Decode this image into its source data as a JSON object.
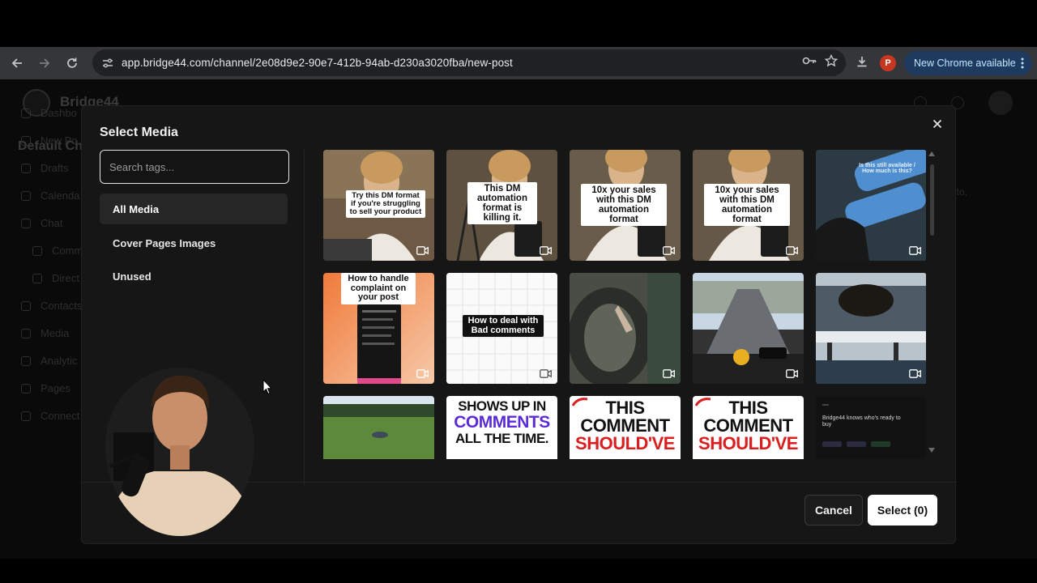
{
  "browser": {
    "url": "app.bridge44.com/channel/2e08d9e2-90e7-412b-94ab-d230a3020fba/new-post",
    "profile_initial": "P",
    "update_label": "New Chrome available"
  },
  "app": {
    "brand": "Bridge44",
    "workspace": "Default Ch",
    "sidebar": [
      "Dashbo",
      "New Po",
      "Drafts",
      "Calenda",
      "Chat",
      "Comm",
      "Direct",
      "Contacts",
      "Media",
      "Analytic",
      "Pages",
      "Connect"
    ],
    "ghost_text": "ct to,"
  },
  "modal": {
    "title": "Select Media",
    "search_placeholder": "Search tags...",
    "tags": [
      {
        "label": "All Media",
        "active": true
      },
      {
        "label": "Cover Pages Images",
        "active": false
      },
      {
        "label": "Unused",
        "active": false
      }
    ],
    "tiles": [
      {
        "caption": "Try this DM format if you're struggling to sell your product",
        "video": true
      },
      {
        "caption": "This DM automation format is killing it.",
        "video": true
      },
      {
        "caption": "10x your sales with this DM automation format",
        "video": true
      },
      {
        "caption": "10x your sales with this DM automation format",
        "video": true
      },
      {
        "caption": "Is this still available / How much is this?",
        "video": true
      },
      {
        "caption": "How to handle complaint on your post",
        "video": true
      },
      {
        "caption": "How to deal with Bad comments",
        "video": true
      },
      {
        "caption": "",
        "video": true
      },
      {
        "caption": "",
        "video": true
      },
      {
        "caption": "",
        "video": true
      },
      {
        "caption": "",
        "video": false
      },
      {
        "caption_lines": [
          "SHOWS UP IN",
          "COMMENTS",
          "ALL THE TIME."
        ],
        "video": false
      },
      {
        "caption_lines": [
          "THIS",
          "COMMENT",
          "SHOULD'VE"
        ],
        "video": false
      },
      {
        "caption_lines": [
          "THIS",
          "COMMENT",
          "SHOULD'VE"
        ],
        "video": false
      },
      {
        "caption": "Bridge44 knows who's ready to buy",
        "video": false
      }
    ],
    "cancel_label": "Cancel",
    "select_label": "Select (0)"
  },
  "colors": {
    "accent_purple": "#5b2bd6",
    "accent_red": "#d81e1e",
    "modal_bg": "#161616"
  }
}
